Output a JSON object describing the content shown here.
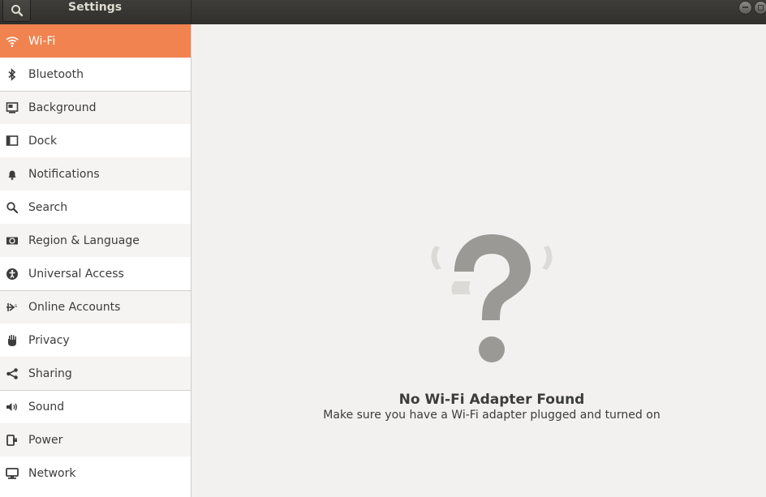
{
  "window": {
    "title": "Settings",
    "search_icon": "search-icon",
    "controls": [
      "minimize",
      "maximize"
    ]
  },
  "sidebar": {
    "items": [
      {
        "label": "Wi-Fi",
        "icon": "wifi-icon",
        "active": true
      },
      {
        "label": "Bluetooth",
        "icon": "bluetooth-icon"
      },
      {
        "label": "Background",
        "icon": "background-icon"
      },
      {
        "label": "Dock",
        "icon": "dock-icon"
      },
      {
        "label": "Notifications",
        "icon": "bell-icon"
      },
      {
        "label": "Search",
        "icon": "search-icon"
      },
      {
        "label": "Region & Language",
        "icon": "region-icon"
      },
      {
        "label": "Universal Access",
        "icon": "accessibility-icon"
      },
      {
        "label": "Online Accounts",
        "icon": "online-accounts-icon"
      },
      {
        "label": "Privacy",
        "icon": "hand-icon"
      },
      {
        "label": "Sharing",
        "icon": "share-icon"
      },
      {
        "label": "Sound",
        "icon": "speaker-icon"
      },
      {
        "label": "Power",
        "icon": "power-icon"
      },
      {
        "label": "Network",
        "icon": "network-icon"
      }
    ]
  },
  "main": {
    "status_icon": "question-mark-icon",
    "title": "No Wi-Fi Adapter Found",
    "subtitle": "Make sure you have a Wi-Fi adapter plugged and turned on"
  },
  "colors": {
    "accent": "#f0834f",
    "titlebar": "#3a3935",
    "icon_gray": "#9b9995"
  }
}
